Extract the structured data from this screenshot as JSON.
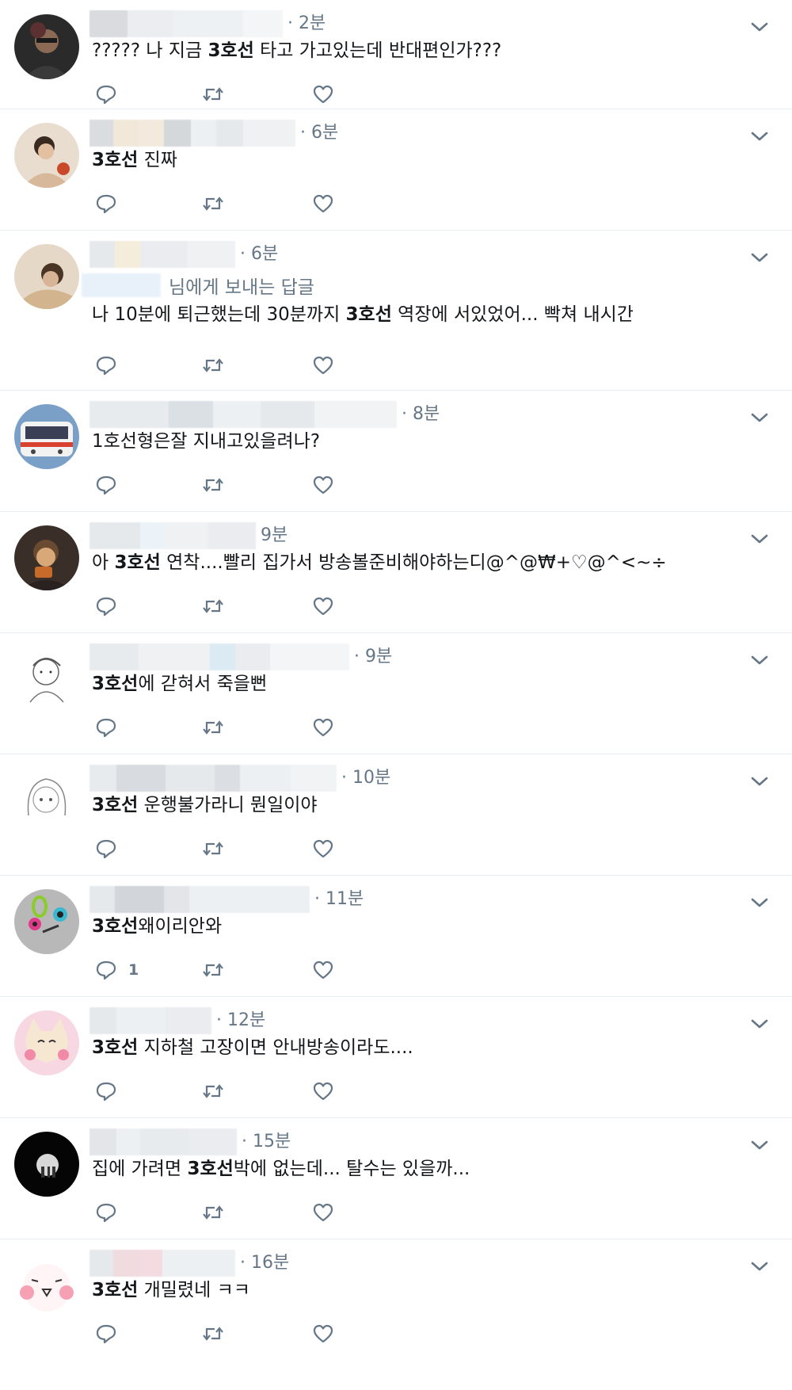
{
  "tweets": [
    {
      "time": "· 2분",
      "segments": [
        [
          "?????  나  지금 ",
          false
        ],
        [
          "3호선",
          true
        ],
        [
          " 타고  가고있는데  반대편인가???",
          false
        ]
      ],
      "reply_count": ""
    },
    {
      "time": "· 6분",
      "segments": [
        [
          "3호선",
          true
        ],
        [
          " 진짜",
          false
        ]
      ],
      "reply_count": ""
    },
    {
      "time": "· 6분",
      "reply_to": "님에게 보내는 답글",
      "segments": [
        [
          "나 10분에 퇴근했는데 30분까지 ",
          false
        ],
        [
          "3호선",
          true
        ],
        [
          " 역장에 서있었어... 빡쳐 내시간",
          false
        ]
      ],
      "reply_count": ""
    },
    {
      "time": "· 8분",
      "segments": [
        [
          "1호선형은잘 지내고있을려나?",
          false
        ]
      ],
      "reply_count": ""
    },
    {
      "time": "9분",
      "segments": [
        [
          "아 ",
          false
        ],
        [
          "3호선",
          true
        ],
        [
          " 연착....빨리 집가서 방송볼준비해야하는디@^@₩+♡@^<~÷",
          false
        ]
      ],
      "reply_count": ""
    },
    {
      "time": "· 9분",
      "segments": [
        [
          "3호선",
          true
        ],
        [
          "에 갇혀서 죽을뻔",
          false
        ]
      ],
      "reply_count": ""
    },
    {
      "time": "· 10분",
      "segments": [
        [
          "3호선",
          true
        ],
        [
          " 운행불가라니 뭔일이야",
          false
        ]
      ],
      "reply_count": ""
    },
    {
      "time": "· 11분",
      "segments": [
        [
          "3호선",
          true
        ],
        [
          "왜이리안와",
          false
        ]
      ],
      "reply_count": "1"
    },
    {
      "time": "· 12분",
      "segments": [
        [
          "3호선",
          true
        ],
        [
          " 지하철 고장이면 안내방송이라도....",
          false
        ]
      ],
      "reply_count": ""
    },
    {
      "time": "· 15분",
      "segments": [
        [
          "집에 가려면 ",
          false
        ],
        [
          "3호선",
          true
        ],
        [
          "박에 없는데... 탈수는 있을까...",
          false
        ]
      ],
      "reply_count": ""
    },
    {
      "time": "· 16분",
      "segments": [
        [
          "3호선",
          true
        ],
        [
          " 개밀렸네 ㅋㅋ",
          false
        ]
      ],
      "reply_count": ""
    }
  ],
  "icons": {
    "reply": "reply-icon",
    "retweet": "retweet-icon",
    "like": "like-icon",
    "caret": "chevron-down-icon"
  },
  "colors": {
    "icon": "#657786",
    "text": "#14171a",
    "divider": "#e6ecf0"
  }
}
